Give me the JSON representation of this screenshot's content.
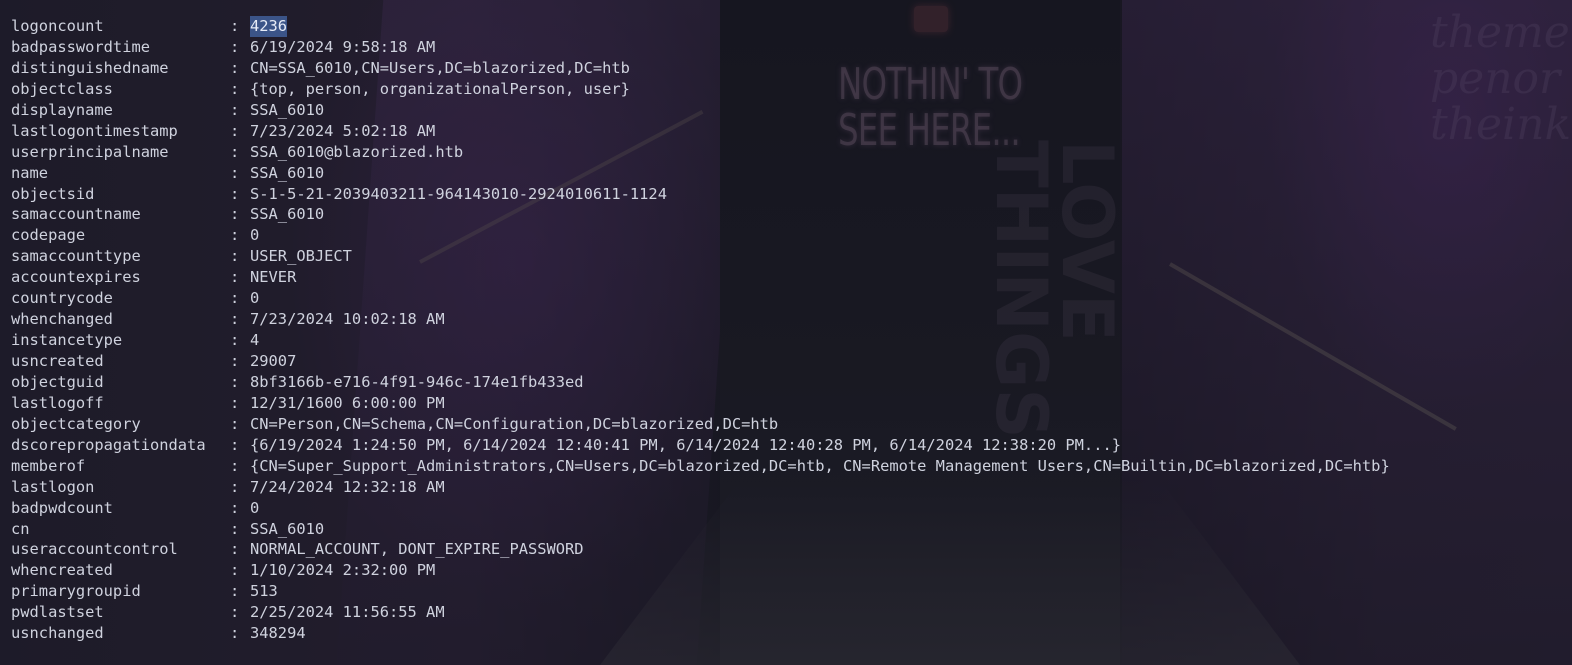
{
  "wallpaper": {
    "sign_text": "NOTHIN' TO\nSEE HERE...",
    "wall_script_right": "theme\npenor\ntheink",
    "wall_art_right": "LOVE\nTHINGS"
  },
  "terminal": {
    "properties": [
      {
        "key": "logoncount",
        "value": "4236",
        "selected": true
      },
      {
        "key": "badpasswordtime",
        "value": "6/19/2024 9:58:18 AM"
      },
      {
        "key": "distinguishedname",
        "value": "CN=SSA_6010,CN=Users,DC=blazorized,DC=htb"
      },
      {
        "key": "objectclass",
        "value": "{top, person, organizationalPerson, user}"
      },
      {
        "key": "displayname",
        "value": "SSA_6010"
      },
      {
        "key": "lastlogontimestamp",
        "value": "7/23/2024 5:02:18 AM"
      },
      {
        "key": "userprincipalname",
        "value": "SSA_6010@blazorized.htb"
      },
      {
        "key": "name",
        "value": "SSA_6010"
      },
      {
        "key": "objectsid",
        "value": "S-1-5-21-2039403211-964143010-2924010611-1124"
      },
      {
        "key": "samaccountname",
        "value": "SSA_6010"
      },
      {
        "key": "codepage",
        "value": "0"
      },
      {
        "key": "samaccounttype",
        "value": "USER_OBJECT"
      },
      {
        "key": "accountexpires",
        "value": "NEVER"
      },
      {
        "key": "countrycode",
        "value": "0"
      },
      {
        "key": "whenchanged",
        "value": "7/23/2024 10:02:18 AM"
      },
      {
        "key": "instancetype",
        "value": "4"
      },
      {
        "key": "usncreated",
        "value": "29007"
      },
      {
        "key": "objectguid",
        "value": "8bf3166b-e716-4f91-946c-174e1fb433ed"
      },
      {
        "key": "lastlogoff",
        "value": "12/31/1600 6:00:00 PM"
      },
      {
        "key": "objectcategory",
        "value": "CN=Person,CN=Schema,CN=Configuration,DC=blazorized,DC=htb"
      },
      {
        "key": "dscorepropagationdata",
        "value": "{6/19/2024 1:24:50 PM, 6/14/2024 12:40:41 PM, 6/14/2024 12:40:28 PM, 6/14/2024 12:38:20 PM...}"
      },
      {
        "key": "memberof",
        "value": "{CN=Super_Support_Administrators,CN=Users,DC=blazorized,DC=htb, CN=Remote Management Users,CN=Builtin,DC=blazorized,DC=htb}"
      },
      {
        "key": "lastlogon",
        "value": "7/24/2024 12:32:18 AM"
      },
      {
        "key": "badpwdcount",
        "value": "0"
      },
      {
        "key": "cn",
        "value": "SSA_6010"
      },
      {
        "key": "useraccountcontrol",
        "value": "NORMAL_ACCOUNT, DONT_EXPIRE_PASSWORD"
      },
      {
        "key": "whencreated",
        "value": "1/10/2024 2:32:00 PM"
      },
      {
        "key": "primarygroupid",
        "value": "513"
      },
      {
        "key": "pwdlastset",
        "value": "2/25/2024 11:56:55 AM"
      },
      {
        "key": "usnchanged",
        "value": "348294"
      }
    ],
    "separator": ":",
    "colors": {
      "text": "#cfd2de",
      "selection": "#3b5488"
    }
  }
}
